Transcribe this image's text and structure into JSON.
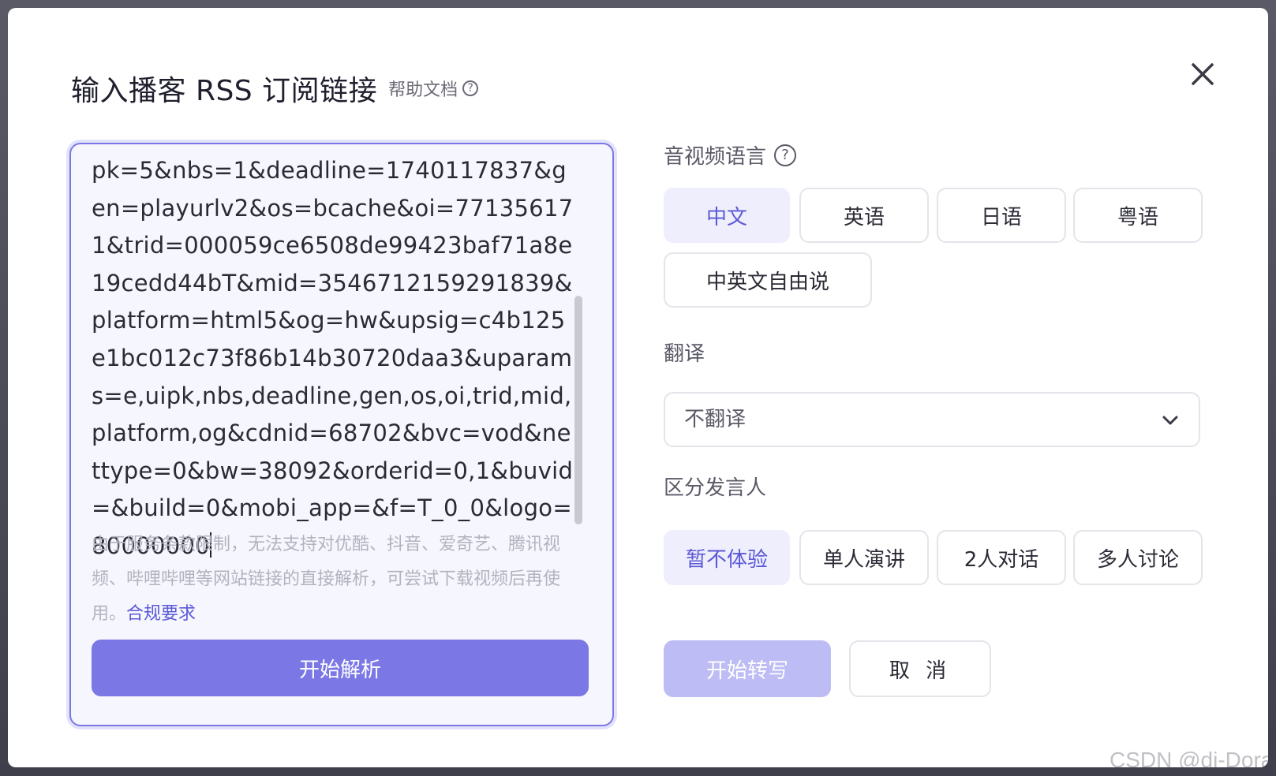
{
  "dialog": {
    "title": "输入播客 RSS 订阅链接",
    "help_label": "帮助文档"
  },
  "input": {
    "url_text": "pk=5&nbs=1&deadline=1740117837&gen=playurlv2&os=bcache&oi=771356171&trid=000059ce6508de99423baf71a8e19cedd44bT&mid=3546712159291839&platform=html5&og=hw&upsig=c4b125e1bc012c73f86b14b30720daa3&uparams=e,uipk,nbs,deadline,gen,os,oi,trid,mid,platform,og&cdnid=68702&bvc=vod&nettype=0&bw=38092&orderid=0,1&buvid=&build=0&mobi_app=&f=T_0_0&logo=80000000",
    "notice": "由于服务条款限制，无法支持对优酷、抖音、爱奇艺、腾讯视频、哔哩哔哩等网站链接的直接解析，可尝试下载视频后再使用。",
    "compliance_link": "合规要求",
    "parse_button": "开始解析"
  },
  "language": {
    "label": "音视频语言",
    "options": [
      "中文",
      "英语",
      "日语",
      "粤语",
      "中英文自由说"
    ],
    "selected": "中文"
  },
  "translation": {
    "label": "翻译",
    "selected": "不翻译"
  },
  "speakers": {
    "label": "区分发言人",
    "options": [
      "暂不体验",
      "单人演讲",
      "2人对话",
      "多人讨论"
    ],
    "selected": "暂不体验"
  },
  "actions": {
    "start_label": "开始转写",
    "cancel_label": "取 消"
  },
  "watermark": "CSDN @di-Dora",
  "colors": {
    "accent": "#7b78e6",
    "accent_text": "#5b59d6",
    "selected_bg": "#efeefd",
    "disabled_accent": "#bdbcf4"
  }
}
